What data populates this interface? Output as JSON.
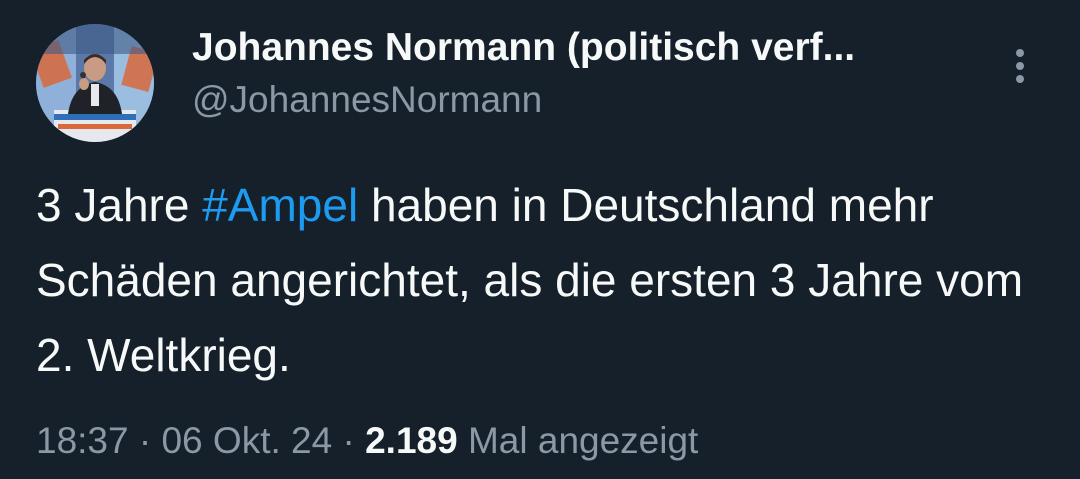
{
  "author": {
    "display_name": "Johannes Normann (politisch verf...",
    "handle": "@JohannesNormann",
    "avatar_icon": "person-speaking-at-podium-photo"
  },
  "more_icon": "vertical-ellipsis-icon",
  "tweet": {
    "text_before_hashtag": "3 Jahre ",
    "hashtag": "#Ampel",
    "text_after_hashtag": " haben in Deutschland mehr Schäden angerichtet, als die ersten 3 Jahre vom 2. Weltkrieg."
  },
  "meta": {
    "time": "18:37",
    "separator": " · ",
    "date": "06 Okt. 24",
    "views_count": "2.189",
    "views_label": " Mal angezeigt"
  },
  "colors": {
    "background": "#15202b",
    "text": "#f7f9f9",
    "secondary": "#8b98a5",
    "accent": "#1d9bf0"
  }
}
